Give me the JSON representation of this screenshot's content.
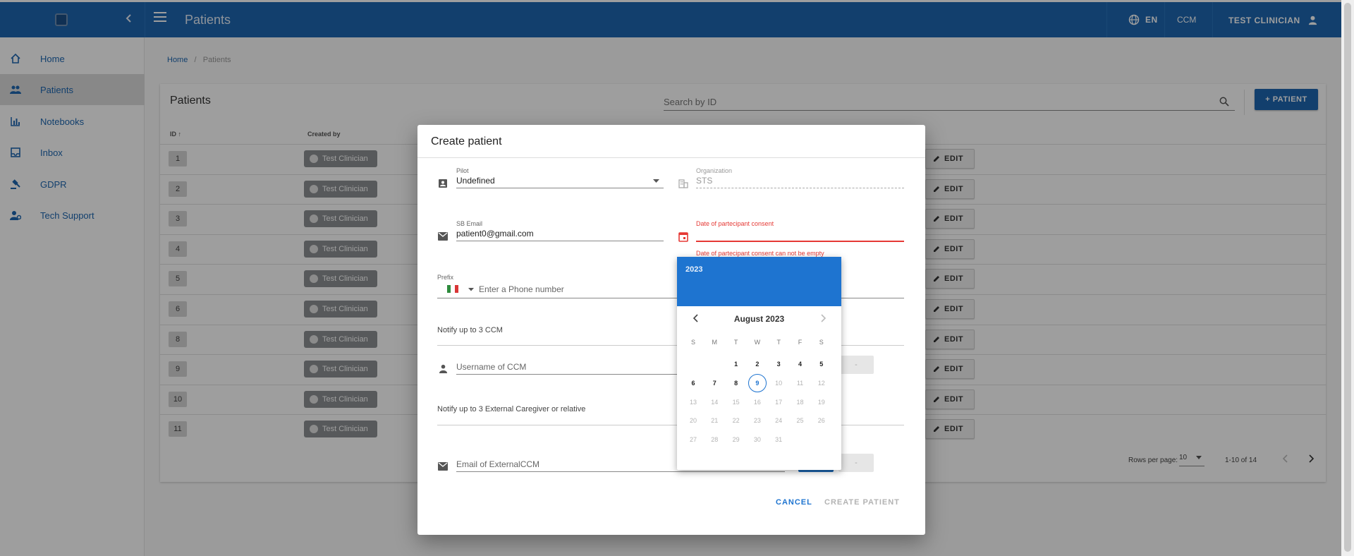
{
  "appbar": {
    "title": "Patients",
    "language": "EN",
    "role": "CCM",
    "user": "TEST CLINICIAN"
  },
  "sidebar": {
    "items": [
      {
        "label": "Home",
        "icon": "home-icon"
      },
      {
        "label": "Patients",
        "icon": "people-icon"
      },
      {
        "label": "Notebooks",
        "icon": "bar-chart-icon"
      },
      {
        "label": "Inbox",
        "icon": "inbox-icon"
      },
      {
        "label": "GDPR",
        "icon": "gavel-icon"
      },
      {
        "label": "Tech Support",
        "icon": "support-icon"
      }
    ]
  },
  "breadcrumb": {
    "home": "Home",
    "separator": "/",
    "current": "Patients"
  },
  "table": {
    "title": "Patients",
    "search_placeholder": "Search by ID",
    "add_button": "+ PATIENT",
    "col_id": "ID",
    "col_id_sort": "↑",
    "col_created_by": "Created by",
    "edit_label": "EDIT",
    "rows": [
      {
        "id": "1",
        "created_by": "Test Clinician"
      },
      {
        "id": "2",
        "created_by": "Test Clinician"
      },
      {
        "id": "3",
        "created_by": "Test Clinician"
      },
      {
        "id": "4",
        "created_by": "Test Clinician"
      },
      {
        "id": "5",
        "created_by": "Test Clinician"
      },
      {
        "id": "6",
        "created_by": "Test Clinician"
      },
      {
        "id": "8",
        "created_by": "Test Clinician"
      },
      {
        "id": "9",
        "created_by": "Test Clinician"
      },
      {
        "id": "10",
        "created_by": "Test Clinician"
      },
      {
        "id": "11",
        "created_by": "Test Clinician"
      }
    ],
    "pagination": {
      "rows_per_page_label": "Rows per page:",
      "rows_per_page": "10",
      "range": "1-10 of 14"
    }
  },
  "dialog": {
    "title": "Create patient",
    "pilot_label": "Pilot",
    "pilot_value": "Undefined",
    "organization_label": "Organization",
    "organization_value": "STS",
    "email_label": "SB Email",
    "email_value": "patient0@gmail.com",
    "consent_label": "Date of partecipant consent",
    "consent_error": "Date of partecipant consent can not be empty",
    "prefix_label": "Prefix",
    "phone_placeholder": "Enter a Phone number",
    "ccm_section": "Notify up to 3 CCM",
    "ccm_placeholder": "Username of CCM",
    "ccm_button": "-",
    "caregiver_section": "Notify up to 3 External Caregiver or relative",
    "caregiver_placeholder": "Email of ExternalCCM",
    "caregiver_button": "-",
    "cancel": "CANCEL",
    "create": "CREATE PATIENT"
  },
  "datepicker": {
    "year": "2023",
    "month": "August 2023",
    "weekdays": [
      "S",
      "M",
      "T",
      "W",
      "T",
      "F",
      "S"
    ],
    "weeks": [
      [
        "",
        "",
        "1",
        "2",
        "3",
        "4",
        "5"
      ],
      [
        "6",
        "7",
        "8",
        "9",
        "10",
        "11",
        "12"
      ],
      [
        "13",
        "14",
        "15",
        "16",
        "17",
        "18",
        "19"
      ],
      [
        "20",
        "21",
        "22",
        "23",
        "24",
        "25",
        "26"
      ],
      [
        "27",
        "28",
        "29",
        "30",
        "31",
        "",
        ""
      ]
    ],
    "today": "9",
    "last_enabled_day": 9
  },
  "colors": {
    "primary": "#1d67b1",
    "picker_header": "#1e74d0",
    "error": "#e53935"
  }
}
